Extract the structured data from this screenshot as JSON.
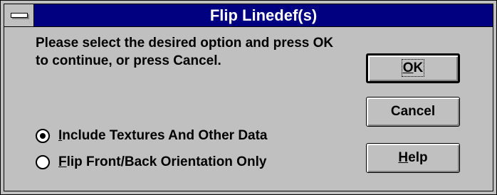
{
  "window": {
    "title": "Flip Linedef(s)"
  },
  "message": "Please select the desired option and press OK to continue, or press Cancel.",
  "options": [
    {
      "mnemonic": "I",
      "rest": "nclude Textures And Other Data",
      "selected": true
    },
    {
      "mnemonic": "F",
      "rest": "lip Front/Back Orientation Only",
      "selected": false
    }
  ],
  "buttons": {
    "ok": {
      "mnemonic": "O",
      "rest": "K"
    },
    "cancel": {
      "label": "Cancel"
    },
    "help": {
      "mnemonic": "H",
      "rest": "elp"
    }
  },
  "colors": {
    "titlebar": "#000080",
    "face": "#c0c0c0"
  },
  "icons": {
    "system_menu": "system-menu-icon"
  }
}
